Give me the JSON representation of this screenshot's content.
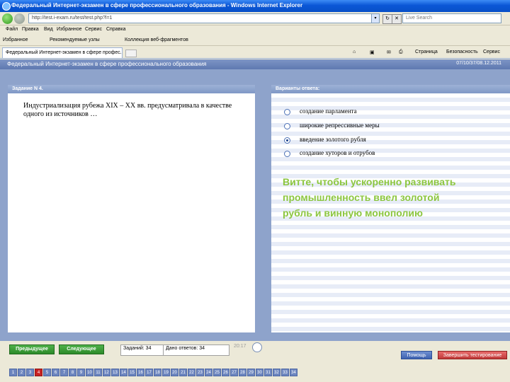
{
  "browser": {
    "window_title": "Федеральный Интернет-экзамен в сфере профессионального образования - Windows Internet Explorer",
    "address": "http://test.i-exam.ru/test/test.php?l=1",
    "search_placeholder": "Live Search",
    "menu": [
      "Файл",
      "Правка",
      "Вид",
      "Избранное",
      "Сервис",
      "Справка"
    ],
    "favorites": [
      "Избранное",
      "Рекомендуемые узлы",
      "Коллекция веб-фрагментов"
    ],
    "tab_title": "Федеральный Интернет-экзамен в сфере профес...",
    "command_items": [
      "Страница",
      "Безопасность",
      "Сервис"
    ]
  },
  "app": {
    "header_title": "Федеральный Интернет-экзамен в сфере профессионального образования",
    "header_info": "07/10/37/08.12.2011"
  },
  "question": {
    "heading": "Задание N 4.",
    "text": "Индустриализация рубежа XIX – XX вв. предусматривала в качестве одного из источников …"
  },
  "answers": {
    "heading": "Варианты ответа:",
    "options": [
      {
        "label": "создание парламента",
        "selected": false
      },
      {
        "label": "широкие репрессивные меры",
        "selected": false
      },
      {
        "label": "введение золотого рубля",
        "selected": true
      },
      {
        "label": "создание хуторов и отрубов",
        "selected": false
      }
    ]
  },
  "note": {
    "text": "Витте, чтобы ускоренно развивать промышленность ввел золотой рубль и винную монополию",
    "color": "#8cc63f"
  },
  "navigation": {
    "prev_label": "Предыдущее",
    "next_label": "Следующее",
    "tasks_label": "Заданий: 34",
    "answered_label": "Дано ответов: 34",
    "timer": "20:17",
    "help_label": "Помощь",
    "end_label": "Завершить тестирование"
  },
  "pages": {
    "numbers": [
      "1",
      "2",
      "3",
      "4",
      "5",
      "6",
      "7",
      "8",
      "9",
      "10",
      "11",
      "12",
      "13",
      "14",
      "15",
      "16",
      "17",
      "18",
      "19",
      "20",
      "21",
      "22",
      "23",
      "24",
      "25",
      "26",
      "27",
      "28",
      "29",
      "30",
      "31",
      "32",
      "33",
      "34"
    ],
    "current": "4"
  }
}
